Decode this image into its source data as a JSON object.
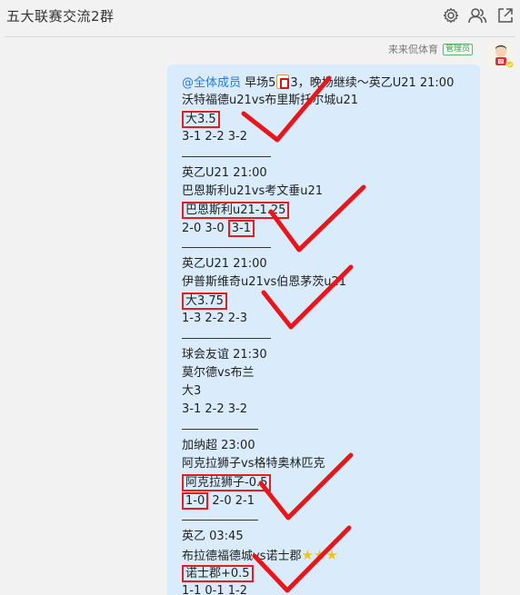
{
  "header": {
    "title": "五大联赛交流2群",
    "icons": [
      "gear-icon",
      "group-members-icon",
      "popout-icon"
    ]
  },
  "message": {
    "sender_name": "来来侃体育",
    "sender_role": "管理员",
    "mention": "@全体成员",
    "intro_text": " 早场5",
    "intro_text_after": "3，晚场继续～英乙U21 21:00",
    "lines": [
      "沃特福德u21vs布里斯托尔城u21",
      "大3.5",
      "3-1  2-2  3-2",
      "英乙U21 21:00",
      "巴恩斯利u21vs考文垂u21",
      "巴恩斯利u21-1.25",
      "2-0  3-0 ",
      "3-1",
      "英乙U21 21:00",
      "伊普斯维奇u21vs伯恩茅茨u21",
      "大3.75",
      "1-3  2-2  2-3",
      "球会友谊 21:30",
      "莫尔德vs布兰",
      "大3",
      "3-1  2-2  3-2",
      "加纳超 23:00",
      "阿克拉狮子vs格特奥林匹克",
      "阿克拉狮子-0.5",
      "1-0",
      " 2-0  2-1",
      "英乙 03:45",
      "布拉德福德城vs诺士郡",
      "★★★",
      "诺士郡+0.5",
      "1-1  0-1  1-2"
    ]
  },
  "colors": {
    "mark_red": "#e02020",
    "bubble_bg": "#daecfb",
    "mention_blue": "#2a7bd5",
    "badge_green": "#3f9b4f"
  }
}
